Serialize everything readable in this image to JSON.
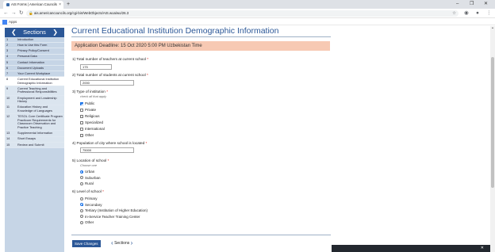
{
  "browser": {
    "tab_title": "AIS Forms | American Councils",
    "new_tab": "+",
    "url": "ais.americancouncils.org/cgi-bin/WebObjects/AIS.woa/wo/26.3",
    "bookmarks_label": "Apps"
  },
  "sidebar": {
    "header": "Sections",
    "items": [
      {
        "num": "1",
        "label": "Introduction",
        "state": "done"
      },
      {
        "num": "2",
        "label": "How to Use this Form",
        "state": "done"
      },
      {
        "num": "3",
        "label": "Privacy Policy/Consent",
        "state": "done"
      },
      {
        "num": "4",
        "label": "Personal Data",
        "state": "done"
      },
      {
        "num": "5",
        "label": "Contact Information",
        "state": "done"
      },
      {
        "num": "6",
        "label": "Document Uploads",
        "state": "done"
      },
      {
        "num": "7",
        "label": "Your Current Workplace",
        "state": "done"
      },
      {
        "num": "8",
        "label": "Current Educational Institution Demographic Information",
        "state": "active"
      },
      {
        "num": "9",
        "label": "Current Teaching and Professional Responsibilities",
        "state": "todo"
      },
      {
        "num": "10",
        "label": "Employment and Leadership History",
        "state": "todo"
      },
      {
        "num": "11",
        "label": "Education History and Knowledge of Languages",
        "state": "todo"
      },
      {
        "num": "12",
        "label": "TESOL Core Certificate Program Practicum Requirements for Classroom Observation and Practice Teaching",
        "state": "todo"
      },
      {
        "num": "13",
        "label": "Supplemental Information",
        "state": "todo"
      },
      {
        "num": "14",
        "label": "Short Essays",
        "state": "todo"
      },
      {
        "num": "15",
        "label": "Review and Submit",
        "state": "todo"
      }
    ]
  },
  "page": {
    "title": "Current Educational Institution Demographic Information",
    "deadline": "Application Deadline: 15 Oct 2020 5:00 PM Uzbekistan Time"
  },
  "questions": {
    "q1": {
      "label": "1)  Total number of teachers at current school",
      "value": "175"
    },
    "q2": {
      "label": "2)  Total number of students at current school",
      "value": "2000"
    },
    "q3": {
      "label": "3)  Type of institution",
      "hint": "check all that apply",
      "options": [
        {
          "label": "Public",
          "checked": true
        },
        {
          "label": "Private",
          "checked": false
        },
        {
          "label": "Religious",
          "checked": false
        },
        {
          "label": "Specialized",
          "checked": false
        },
        {
          "label": "International",
          "checked": false
        },
        {
          "label": "Other",
          "checked": false
        }
      ]
    },
    "q4": {
      "label": "4)  Population of city where school is located",
      "value": "75000"
    },
    "q5": {
      "label": "5)  Location of school",
      "hint": "Choose one",
      "options": [
        {
          "label": "Urban",
          "checked": true
        },
        {
          "label": "Suburban",
          "checked": false
        },
        {
          "label": "Rural",
          "checked": false
        }
      ]
    },
    "q6": {
      "label": "6)  Level of school",
      "options": [
        {
          "label": "Primary",
          "checked": false
        },
        {
          "label": "Secondary",
          "checked": true
        },
        {
          "label": "Tertiary (Institution of Higher Education)",
          "checked": false
        },
        {
          "label": "In-Service Teacher Training Center",
          "checked": false
        },
        {
          "label": "Other",
          "checked": false
        }
      ]
    },
    "required_mark": "*"
  },
  "footer": {
    "save_label": "Save Changes",
    "sections_nav_label": "Sections"
  },
  "colors": {
    "accent": "#2b5797",
    "deadline_bg": "#f7c9b3",
    "sidebar_bg": "#c6d5e6",
    "required": "#d9261c"
  }
}
